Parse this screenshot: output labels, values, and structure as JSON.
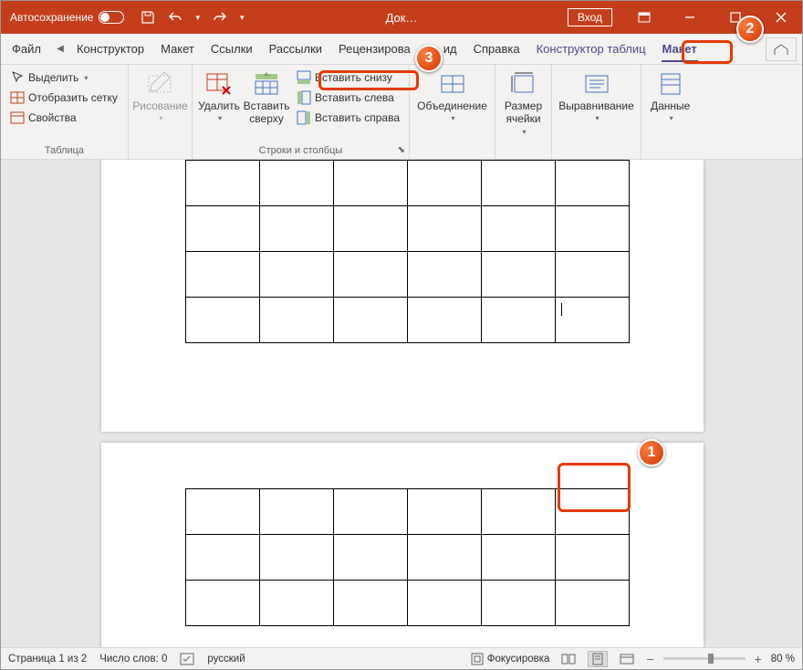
{
  "title": {
    "autosave": "Автосохранение",
    "doc": "Док…",
    "login": "Вход"
  },
  "tabs": {
    "file": "Файл",
    "constructor": "Конструктор",
    "layout": "Макет",
    "links": "Ссылки",
    "mailings": "Рассылки",
    "review": "Рецензирова",
    "view": "ид",
    "help": "Справка",
    "table_design": "Конструктор таблиц",
    "table_layout": "Макет"
  },
  "ribbon": {
    "table_group": {
      "label": "Таблица",
      "select": "Выделить",
      "show_grid": "Отобразить сетку",
      "properties": "Свойства"
    },
    "draw": "Рисование",
    "delete": "Удалить",
    "insert_above": "Вставить\nсверху",
    "insert_below": "Вставить снизу",
    "insert_left": "Вставить слева",
    "insert_right": "Вставить справа",
    "rows_cols": "Строки и столбцы",
    "merge": "Объединение",
    "cell_size": "Размер\nячейки",
    "align": "Выравнивание",
    "data": "Данные"
  },
  "status": {
    "page": "Страница 1 из 2",
    "words": "Число слов: 0",
    "lang": "русский",
    "focus": "Фокусировка",
    "zoom": "80 %"
  },
  "callouts": {
    "c1": "1",
    "c2": "2",
    "c3": "3"
  }
}
